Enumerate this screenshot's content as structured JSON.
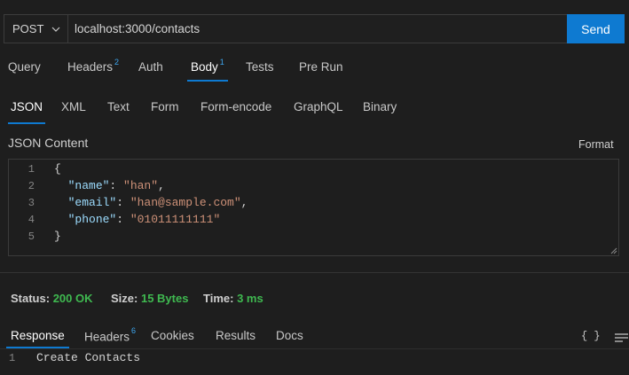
{
  "request": {
    "method": "POST",
    "url": "localhost:3000/contacts",
    "send_label": "Send"
  },
  "tabs": [
    {
      "label": "Query",
      "badge": ""
    },
    {
      "label": "Headers",
      "badge": "2"
    },
    {
      "label": "Auth",
      "badge": ""
    },
    {
      "label": "Body",
      "badge": "1"
    },
    {
      "label": "Tests",
      "badge": ""
    },
    {
      "label": "Pre Run",
      "badge": ""
    }
  ],
  "body_tabs": [
    "JSON",
    "XML",
    "Text",
    "Form",
    "Form-encode",
    "GraphQL",
    "Binary"
  ],
  "json_section": {
    "title": "JSON Content",
    "format_label": "Format"
  },
  "editor": {
    "line_numbers": [
      "1",
      "2",
      "3",
      "4",
      "5"
    ],
    "open_brace": "{",
    "close_brace": "}",
    "fields": [
      {
        "key": "\"name\"",
        "value": "\"han\"",
        "trail": ","
      },
      {
        "key": "\"email\"",
        "value": "\"han@sample.com\"",
        "trail": ","
      },
      {
        "key": "\"phone\"",
        "value": "\"01011111111\"",
        "trail": ""
      }
    ]
  },
  "status": {
    "status_label": "Status:",
    "status_value": "200 OK",
    "size_label": "Size:",
    "size_value": "15 Bytes",
    "time_label": "Time:",
    "time_value": "3 ms"
  },
  "response_tabs": [
    {
      "label": "Response",
      "badge": ""
    },
    {
      "label": "Headers",
      "badge": "6"
    },
    {
      "label": "Cookies",
      "badge": ""
    },
    {
      "label": "Results",
      "badge": ""
    },
    {
      "label": "Docs",
      "badge": ""
    }
  ],
  "response_icons": {
    "braces": "{ }"
  },
  "response_body": {
    "line_number": "1",
    "text": "Create Contacts"
  },
  "colors": {
    "accent": "#0e7ad1",
    "success": "#3fb950",
    "json_key": "#9cdcfe",
    "json_string": "#ce9178"
  }
}
